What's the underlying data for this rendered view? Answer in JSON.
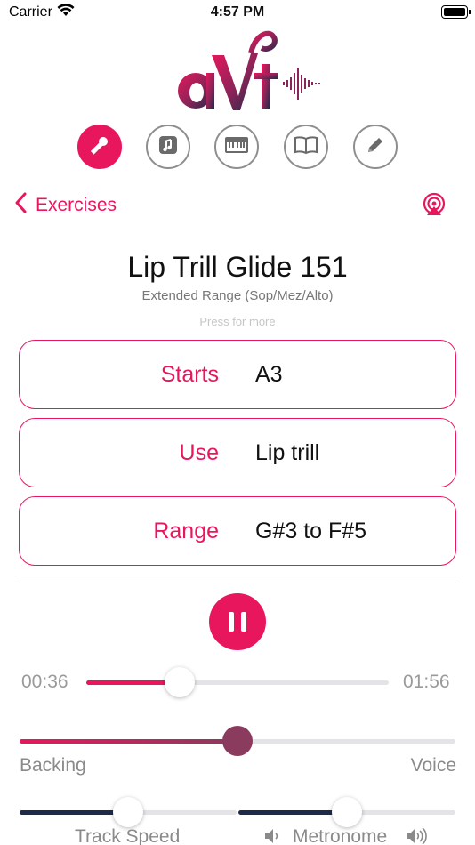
{
  "status_bar": {
    "carrier": "Carrier",
    "time": "4:57 PM",
    "battery_level": 1.0
  },
  "logo": {
    "text": "avt"
  },
  "tabs": [
    {
      "icon": "microphone-icon",
      "active": true
    },
    {
      "icon": "music-note-icon",
      "active": false
    },
    {
      "icon": "keyboard-icon",
      "active": false
    },
    {
      "icon": "book-icon",
      "active": false
    },
    {
      "icon": "pencil-icon",
      "active": false
    }
  ],
  "nav": {
    "back_label": "Exercises",
    "airplay_icon": "airplay-icon"
  },
  "exercise": {
    "title": "Lip Trill Glide 151",
    "subtitle": "Extended Range (Sop/Mez/Alto)",
    "press_more": "Press for more",
    "rows": [
      {
        "label": "Starts",
        "value": "A3"
      },
      {
        "label": "Use",
        "value": "Lip trill"
      },
      {
        "label": "Range",
        "value": "G#3 to F#5"
      }
    ]
  },
  "player": {
    "state": "playing",
    "elapsed": "00:36",
    "duration": "01:56",
    "progress": 0.31,
    "mix": {
      "left_label": "Backing",
      "right_label": "Voice",
      "value": 0.5
    },
    "track_speed": {
      "label": "Track Speed",
      "value": 0.5
    },
    "metronome": {
      "label": "Metronome",
      "value": 0.5
    }
  },
  "colors": {
    "accent": "#e8175d",
    "navy": "#1d2a4a",
    "mix_knob": "#8a3b5e",
    "muted_text": "#9a9a9a"
  }
}
